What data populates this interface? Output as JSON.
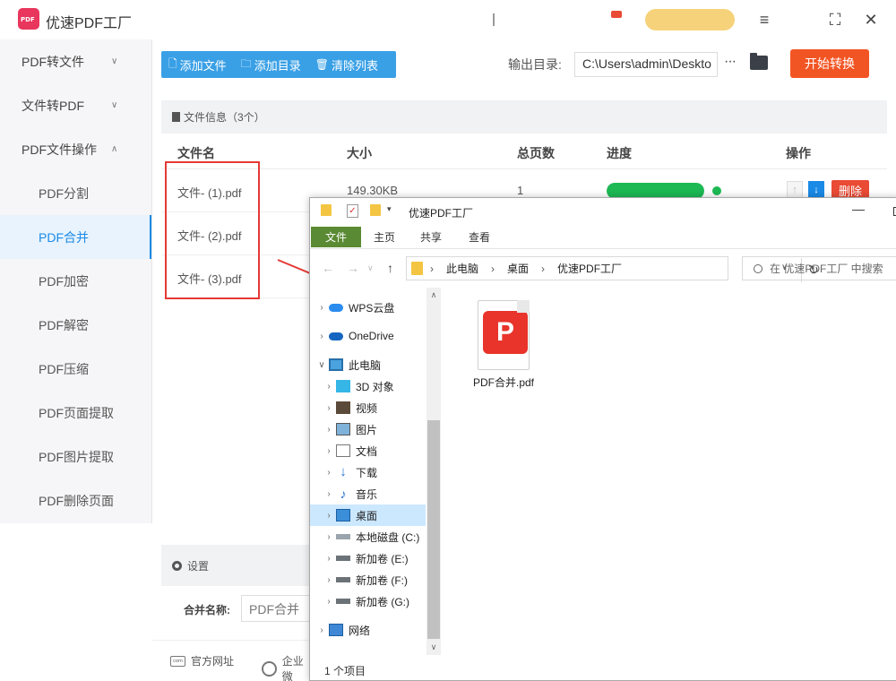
{
  "app": {
    "title": "优速PDF工厂"
  },
  "sidebar": {
    "items": [
      {
        "label": "PDF转文件",
        "chevron": "∨"
      },
      {
        "label": "文件转PDF",
        "chevron": "∨"
      },
      {
        "label": "PDF文件操作",
        "chevron": "∧"
      },
      {
        "label": "PDF分割"
      },
      {
        "label": "PDF合并"
      },
      {
        "label": "PDF加密"
      },
      {
        "label": "PDF解密"
      },
      {
        "label": "PDF压缩"
      },
      {
        "label": "PDF页面提取"
      },
      {
        "label": "PDF图片提取"
      },
      {
        "label": "PDF删除页面"
      }
    ]
  },
  "toolbar": {
    "add_file": "添加文件",
    "add_dir": "添加目录",
    "clear_list": "清除列表",
    "output_label": "输出目录:",
    "output_path": "C:\\Users\\admin\\Deskto",
    "more": "···",
    "start": "开始转换"
  },
  "file_panel": {
    "info": "文件信息（3个）",
    "headers": {
      "name": "文件名",
      "size": "大小",
      "pages": "总页数",
      "progress": "进度",
      "action": "操作"
    },
    "rows": [
      {
        "name": "文件- (1).pdf",
        "size": "149.30KB",
        "pages": "1",
        "progress": 1.0,
        "delete": "删除"
      },
      {
        "name": "文件- (2).pdf"
      },
      {
        "name": "文件- (3).pdf"
      }
    ]
  },
  "settings": {
    "title": "设置",
    "merge_label": "合并名称:",
    "merge_value": "PDF合并"
  },
  "footer": {
    "website": "官方网址",
    "enterprise": "企业微"
  },
  "explorer": {
    "title": "优速PDF工厂",
    "ribbon": [
      "文件",
      "主页",
      "共享",
      "查看"
    ],
    "breadcrumb": [
      "此电脑",
      "桌面",
      "优速PDF工厂"
    ],
    "search_placeholder": "在 优速PDF工厂 中搜索",
    "tree": [
      {
        "label": "WPS云盘",
        "icon": "cloud-icon"
      },
      {
        "label": "OneDrive",
        "icon": "onedrive-icon"
      },
      {
        "label": "此电脑",
        "icon": "pc-icon"
      },
      {
        "label": "3D 对象",
        "icon": "cube-icon"
      },
      {
        "label": "视频",
        "icon": "video-icon"
      },
      {
        "label": "图片",
        "icon": "picture-icon"
      },
      {
        "label": "文档",
        "icon": "document-icon"
      },
      {
        "label": "下载",
        "icon": "download-icon"
      },
      {
        "label": "音乐",
        "icon": "music-icon"
      },
      {
        "label": "桌面",
        "icon": "desktop-icon"
      },
      {
        "label": "本地磁盘 (C:)",
        "icon": "drive-icon"
      },
      {
        "label": "新加卷 (E:)",
        "icon": "drive-icon"
      },
      {
        "label": "新加卷 (F:)",
        "icon": "drive-icon"
      },
      {
        "label": "新加卷 (G:)",
        "icon": "drive-icon"
      },
      {
        "label": "网络",
        "icon": "network-icon"
      }
    ],
    "file": {
      "name": "PDF合并.pdf"
    },
    "status": "1 个项目"
  },
  "colors": {
    "accent": "#1a8ae6",
    "toolbar": "#3aa0e6",
    "start": "#f25524",
    "delete": "#e94b35",
    "progress": "#1db954",
    "annotation": "#e53935"
  }
}
